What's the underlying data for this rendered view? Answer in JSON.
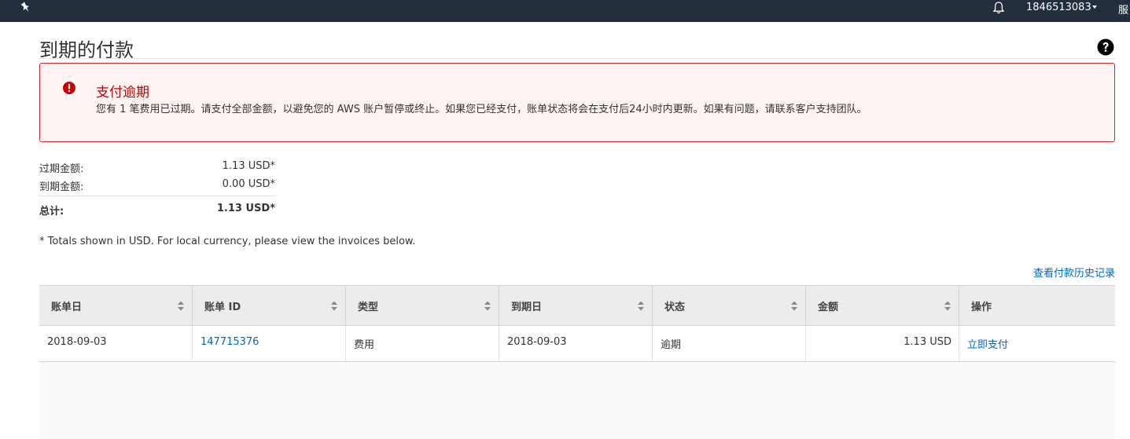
{
  "topbar": {
    "pin_icon": "pin-icon",
    "bell_icon": "bell-icon",
    "account_id": "1846513083",
    "services_label": "服"
  },
  "page": {
    "title": "到期的付款",
    "help_icon": "question-circle-icon"
  },
  "alert": {
    "icon": "exclamation-circle-icon",
    "title": "支付逾期",
    "message": "您有 1 笔费用已过期。请支付全部金额，以避免您的 AWS 账户暂停或终止。如果您已经支付，账单状态将会在支付后24小时内更新。如果有问题，请联系客户支持团队。",
    "color": "#c40000"
  },
  "summary": {
    "overdue_label": "过期金额:",
    "overdue_value": "1.13 USD*",
    "due_label": "到期金额:",
    "due_value": "0.00 USD*",
    "total_label": "总计:",
    "total_value": "1.13 USD*"
  },
  "footnote": "* Totals shown in USD. For local currency, please view the invoices below.",
  "history_link": "查看付款历史记录",
  "table": {
    "columns": [
      "账单日",
      "账单 ID",
      "类型",
      "到期日",
      "状态",
      "金额",
      "操作"
    ],
    "rows": [
      {
        "bill_date": "2018-09-03",
        "bill_id": "147715376",
        "type": "费用",
        "due_date": "2018-09-03",
        "status": "逾期",
        "amount": "1.13 USD",
        "action": "立即支付"
      }
    ]
  },
  "colors": {
    "nav_bg": "#232f3e",
    "link": "#0066c0",
    "alert_border": "#c62828"
  }
}
